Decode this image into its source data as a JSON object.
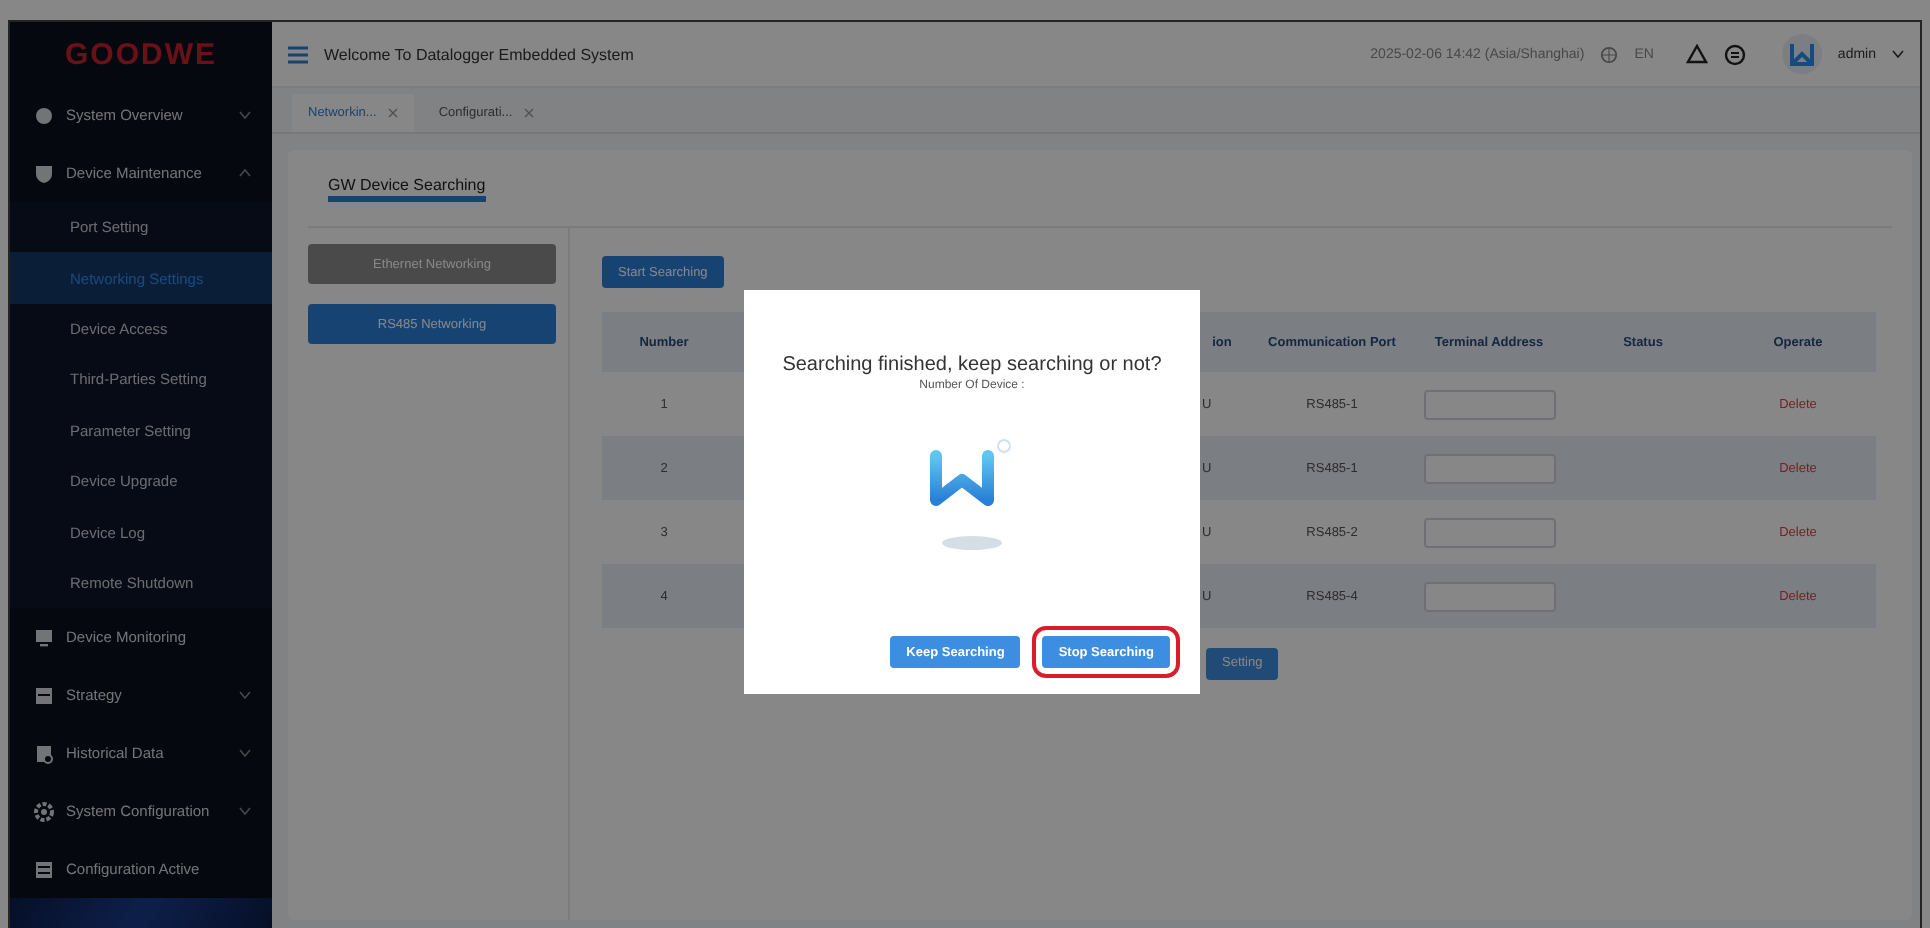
{
  "sidebar": {
    "logo": "GOODWE",
    "items": [
      {
        "label": "System Overview",
        "kind": "group",
        "expanded": false
      },
      {
        "label": "Device Maintenance",
        "kind": "group",
        "expanded": true,
        "children": [
          {
            "label": "Port Setting",
            "selected": false
          },
          {
            "label": "Networking Settings",
            "selected": true
          },
          {
            "label": "Device Access",
            "selected": false
          },
          {
            "label": "Third-Parties Setting",
            "selected": false
          },
          {
            "label": "Parameter Setting",
            "selected": false
          },
          {
            "label": "Device Upgrade",
            "selected": false
          },
          {
            "label": "Device Log",
            "selected": false
          },
          {
            "label": "Remote Shutdown",
            "selected": false
          }
        ]
      },
      {
        "label": "Device Monitoring",
        "kind": "link"
      },
      {
        "label": "Strategy",
        "kind": "group",
        "expanded": false
      },
      {
        "label": "Historical Data",
        "kind": "group",
        "expanded": false
      },
      {
        "label": "System Configuration",
        "kind": "group",
        "expanded": false
      },
      {
        "label": "Configuration Active",
        "kind": "link"
      }
    ]
  },
  "header": {
    "title": "Welcome To Datalogger Embedded System",
    "datetime": "2025-02-06 14:42 (Asia/Shanghai)",
    "language": "EN",
    "user": "admin"
  },
  "tabs": [
    {
      "label": "Networkin...",
      "selected": true
    },
    {
      "label": "Configurati...",
      "selected": false
    }
  ],
  "panel": {
    "title": "GW Device Searching",
    "modes": [
      {
        "label": "Ethernet Networking",
        "selected": false
      },
      {
        "label": "RS485 Networking",
        "selected": true
      }
    ],
    "start_button": "Start Searching",
    "table": {
      "columns": [
        "Number",
        "",
        "ion",
        "Communication Port",
        "Terminal Address",
        "Status",
        "Operate"
      ],
      "rows": [
        {
          "number": "1",
          "column_3": "U",
          "port": "RS485-1",
          "operate": "Delete"
        },
        {
          "number": "2",
          "column_3": "U",
          "port": "RS485-1",
          "operate": "Delete"
        },
        {
          "number": "3",
          "column_3": "U",
          "port": "RS485-2",
          "operate": "Delete"
        },
        {
          "number": "4",
          "column_3": "U",
          "port": "RS485-4",
          "operate": "Delete"
        }
      ]
    },
    "setting_button": "Setting"
  },
  "dialog": {
    "title": "Searching finished, keep searching or not?",
    "subtitle": "Number Of Device :",
    "buttons": [
      {
        "label": "Keep Searching",
        "highlighted": false
      },
      {
        "label": "Stop Searching",
        "highlighted": true
      }
    ]
  }
}
